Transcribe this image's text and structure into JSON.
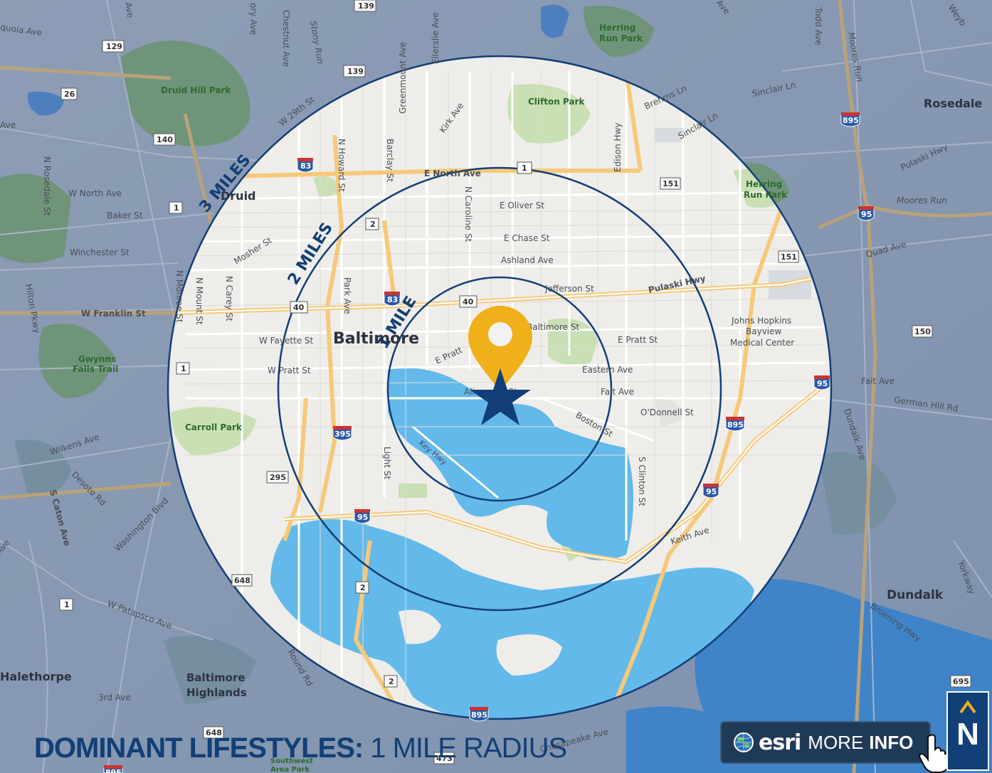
{
  "title": {
    "bold": "DOMINANT LIFESTYLES:",
    "light": "1 MILE RADIUS"
  },
  "rings": [
    "1 MILE",
    "2 MILES",
    "3 MILES"
  ],
  "cities": {
    "baltimore": "Baltimore",
    "druid": "Druid",
    "rosedale": "Rosedale",
    "dundalk": "Dundalk",
    "halethorpe": "Halethorpe",
    "baltimore_highlands": [
      "Baltimore",
      "Highlands"
    ]
  },
  "parks": {
    "herring_run_park": [
      "Herring",
      "Run Park"
    ],
    "herring_run_park2": [
      "Herring",
      "Run Park"
    ],
    "druid_hill_park": "Druid Hill Park",
    "clifton_park": "Clifton Park",
    "gwynns_falls_trail": [
      "Gwynns",
      "Falls Trail"
    ],
    "carroll_park": "Carroll Park",
    "johns_hopkins": [
      "Johns Hopkins",
      "Bayview",
      "Medical Center"
    ],
    "southwest_area_park": [
      "Southwest",
      "Area Park"
    ]
  },
  "streets": {
    "sequoia": "quoia Ave",
    "north_ave_w": "W North Ave",
    "baker": "Baker St",
    "winchester": "Winchester St",
    "franklin": "W Franklin St",
    "rosedale_st": "N Rosedale St",
    "hilton": "Hilton Pkwy",
    "w29": "W 29th St",
    "mosher": "Mosher St",
    "n_monroe": "N Monroe St",
    "n_mount": "N Mount St",
    "n_carey": "N Carey St",
    "w_fayette": "W Fayette St",
    "w_pratt": "W Pratt St",
    "park_ave": "Park Ave",
    "n_howard": "N Howard St",
    "barclay": "Barclay St",
    "greenmount": "Greenmount Ave",
    "ellerslie": "Ellerslie Ave",
    "kirk": "Kirk Ave",
    "e_north": "E North Ave",
    "n_caroline": "N Caroline St",
    "e_oliver": "E Oliver St",
    "e_chase": "E Chase St",
    "ashland": "Ashland Ave",
    "jefferson": "Jefferson St",
    "pulaski": "Pulaski Hwy",
    "edison": "Edison Hwy",
    "sinclair": "Sinclair Ln",
    "sinclair_ln2": "Sinclair Ln",
    "brehms": "Brehms Ln",
    "e_pratt": "E Pratt St",
    "e_pratt2": "E Pratt",
    "baltimore_st": "Baltimore St",
    "eastern": "Eastern Ave",
    "fait": "Fait Ave",
    "fait2": "Fait Ave",
    "odonnell": "O'Donnell St",
    "boston": "Boston St",
    "aliceanna": "Aliceanna St",
    "key_hwy": "Key Hwy",
    "light": "Light St",
    "s_clinton": "S Clinton St",
    "keith": "Keith Ave",
    "wilkens": "Wilkens Ave",
    "desoto": "Desoto Rd",
    "washington": "Washington Blvd",
    "s_caton": "S Caton Ave",
    "w_patapsco": "W Patapsco Ave",
    "third": "3rd Ave",
    "hammonds": "Round Rd",
    "chesapeake": "Chesapeake Ave",
    "quad": "Quad Ave",
    "moores_run": "Moores Run",
    "moores_run2": "Moores Run",
    "pulaski2": "Pulaski Hwy",
    "german_hill": "German Hill Rd",
    "dundalk_ave": "Dundalk Ave",
    "broening": "Broening Hwy",
    "yorkway": "Yorkway",
    "todd": "Todd Ave",
    "stony_run": "Stony Run",
    "chestnut": "Chestnut Ave",
    "weyb": "Weyb",
    "ave_top": "Ave",
    "ave_left": "Ave",
    "ave_left2": "Ave",
    "ory_ave": "ory Ave",
    "ave_topright": "Ave"
  },
  "shields": {
    "s139a": "139",
    "s139b": "139",
    "s129": "129",
    "s26": "26",
    "s140": "140",
    "s83a": "83",
    "s83b": "83",
    "s1a": "1",
    "s1b": "1",
    "s1c": "1",
    "s1d": "1",
    "s2a": "2",
    "s2b": "2",
    "s2c": "2",
    "s40a": "40",
    "s40b": "40",
    "s151a": "151",
    "s151b": "151",
    "s895a": "895",
    "s895b": "895",
    "s895c": "895",
    "s895d": "895",
    "s95a": "95",
    "s95b": "95",
    "s95c": "95",
    "s95d": "95",
    "s395": "395",
    "s295": "295",
    "s648a": "648",
    "s648b": "648",
    "s150": "150",
    "s695": "695",
    "s473": "473"
  },
  "buttons": {
    "esri_brand": "esri",
    "more": "MORE",
    "info": "INFO"
  },
  "north_label": "N",
  "colors": {
    "navy": "#123f77",
    "water": "#63b9ea",
    "pin": "#f0b01a"
  }
}
